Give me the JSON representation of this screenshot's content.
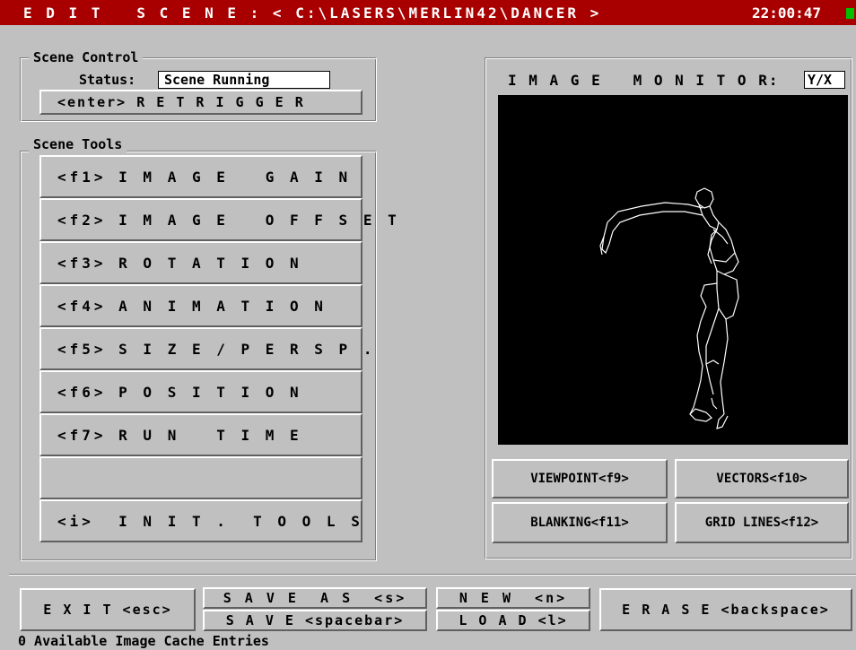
{
  "titlebar": {
    "title": "E D I T   S C E N E : < C:\\LASERS\\MERLIN42\\DANCER >",
    "clock": "22:00:47"
  },
  "scene_control": {
    "legend": "Scene Control",
    "status_label": "Status:",
    "status_value": "Scene Running",
    "retrigger_label": "<enter> R E T R I G G E R"
  },
  "scene_tools": {
    "legend": "Scene Tools",
    "items": [
      "<f1> I M A G E   G A I N",
      "<f2> I M A G E   O F F S E T",
      "<f3> R O T A T I O N",
      "<f4> A N I M A T I O N",
      "<f5> S I Z E / P E R S P .",
      "<f6> P O S I T I O N",
      "<f7> R U N   T I M E",
      "",
      "<i>  I N I T .  T O O L S"
    ]
  },
  "monitor": {
    "label": "I M A G E   M O N I T O R:",
    "mode": "Y/X",
    "viewpoint": "VIEWPOINT<f9>",
    "vectors": "VECTORS<f10>",
    "blanking": "BLANKING<f11>",
    "grid_lines": "GRID LINES<f12>"
  },
  "bottom": {
    "exit": "E X I T <esc>",
    "save_as": "S A V E  A S  <s>",
    "save": "S A V E <spacebar>",
    "new": "N E W  <n>",
    "load": "L O A D <l>",
    "erase": "E R A S E <backspace>"
  },
  "status_line": "0 Available Image Cache Entries",
  "colors": {
    "titlebar_bg": "#a80000",
    "panel_bg": "#c0c0c0",
    "monitor_bg": "#000000",
    "clock_cursor": "#00c000"
  }
}
